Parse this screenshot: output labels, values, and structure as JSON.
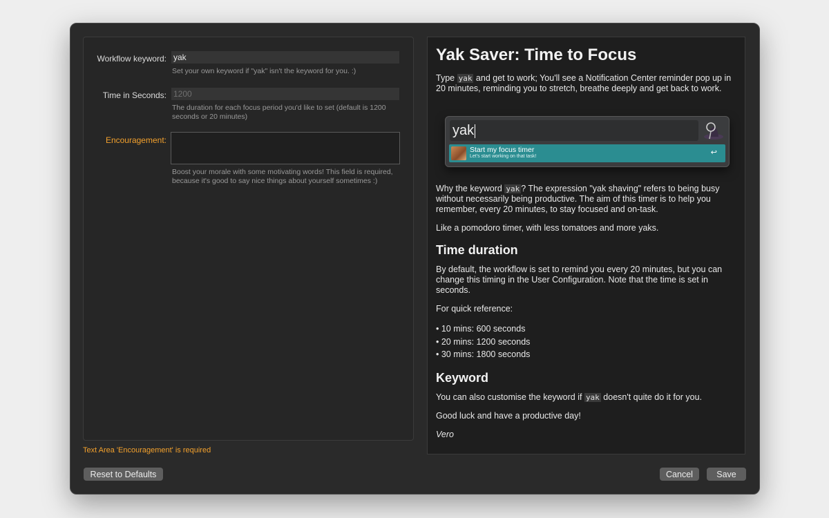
{
  "form": {
    "keyword": {
      "label": "Workflow keyword:",
      "value": "yak",
      "help": "Set your own keyword if \"yak\" isn't the keyword for you. :)"
    },
    "seconds": {
      "label": "Time in Seconds:",
      "placeholder": "1200",
      "help": "The duration for each focus period you'd like to set (default is 1200 seconds or 20 minutes)"
    },
    "encouragement": {
      "label": "Encouragement:",
      "value": "",
      "help": "Boost your morale with some motivating words! This field is required, because it's good to say nice things about yourself sometimes :)"
    },
    "error": "Text Area 'Encouragement' is required"
  },
  "readme": {
    "title": "Yak Saver: Time to Focus",
    "intro": {
      "before": "Type ",
      "code": "yak",
      "after": " and get to work; You'll see a Notification Center reminder pop up in 20 minutes, reminding you to stretch, breathe deeply and get back to work."
    },
    "preview": {
      "query": "yak",
      "result_title": "Start my focus timer",
      "result_subtitle": "Let's start working on that task!",
      "return_symbol": "↩"
    },
    "why": {
      "before": "Why the keyword ",
      "code": "yak",
      "after": "? The expression \"yak shaving\" refers to being busy without necessarily being productive. The aim of this timer is to help you remember, every 20 minutes, to stay focused and on-task."
    },
    "pomodoro": "Like a pomodoro timer, with less tomatoes and more yaks.",
    "duration_heading": "Time duration",
    "duration_text": "By default, the workflow is set to remind you every 20 minutes, but you can change this timing in the User Configuration. Note that the time is set in seconds.",
    "quick_ref": "For quick reference:",
    "reference_list": [
      "10 mins: 600 seconds",
      "20 mins: 1200 seconds",
      "30 mins: 1800 seconds"
    ],
    "keyword_heading": "Keyword",
    "keyword_text": {
      "before": "You can also customise the keyword if ",
      "code": "yak",
      "after": " doesn't quite do it for you."
    },
    "good_luck": "Good luck and have a productive day!",
    "signature": "Vero"
  },
  "buttons": {
    "reset": "Reset to Defaults",
    "cancel": "Cancel",
    "save": "Save"
  },
  "colors": {
    "warning": "#f3a12d",
    "result_highlight": "#2b8d91"
  }
}
